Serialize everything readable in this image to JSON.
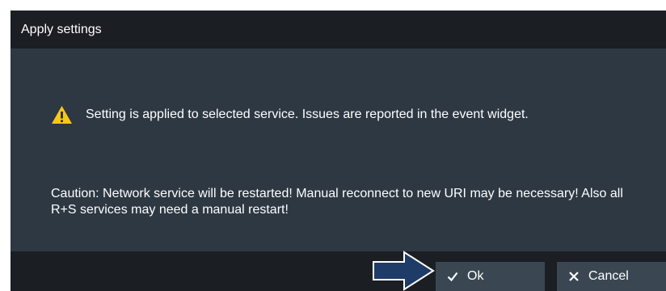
{
  "dialog": {
    "title": "Apply settings",
    "info_icon": "warning-triangle-icon",
    "info_message": "Setting is applied to selected service. Issues are reported in the event widget.",
    "caution_message": "Caution: Network service will be restarted! Manual reconnect to new URI may be necessary! Also all R+S services may need a manual restart!"
  },
  "buttons": {
    "ok_label": "Ok",
    "ok_icon": "checkmark-icon",
    "cancel_label": "Cancel",
    "cancel_icon": "x-icon"
  },
  "annotation": {
    "arrow_icon": "right-arrow-icon"
  },
  "colors": {
    "title_bar": "#1b1e23",
    "dialog_body": "#2d3842",
    "button": "#3a4753",
    "warning": "#f7c719",
    "arrow_fill": "#1f3b67"
  }
}
